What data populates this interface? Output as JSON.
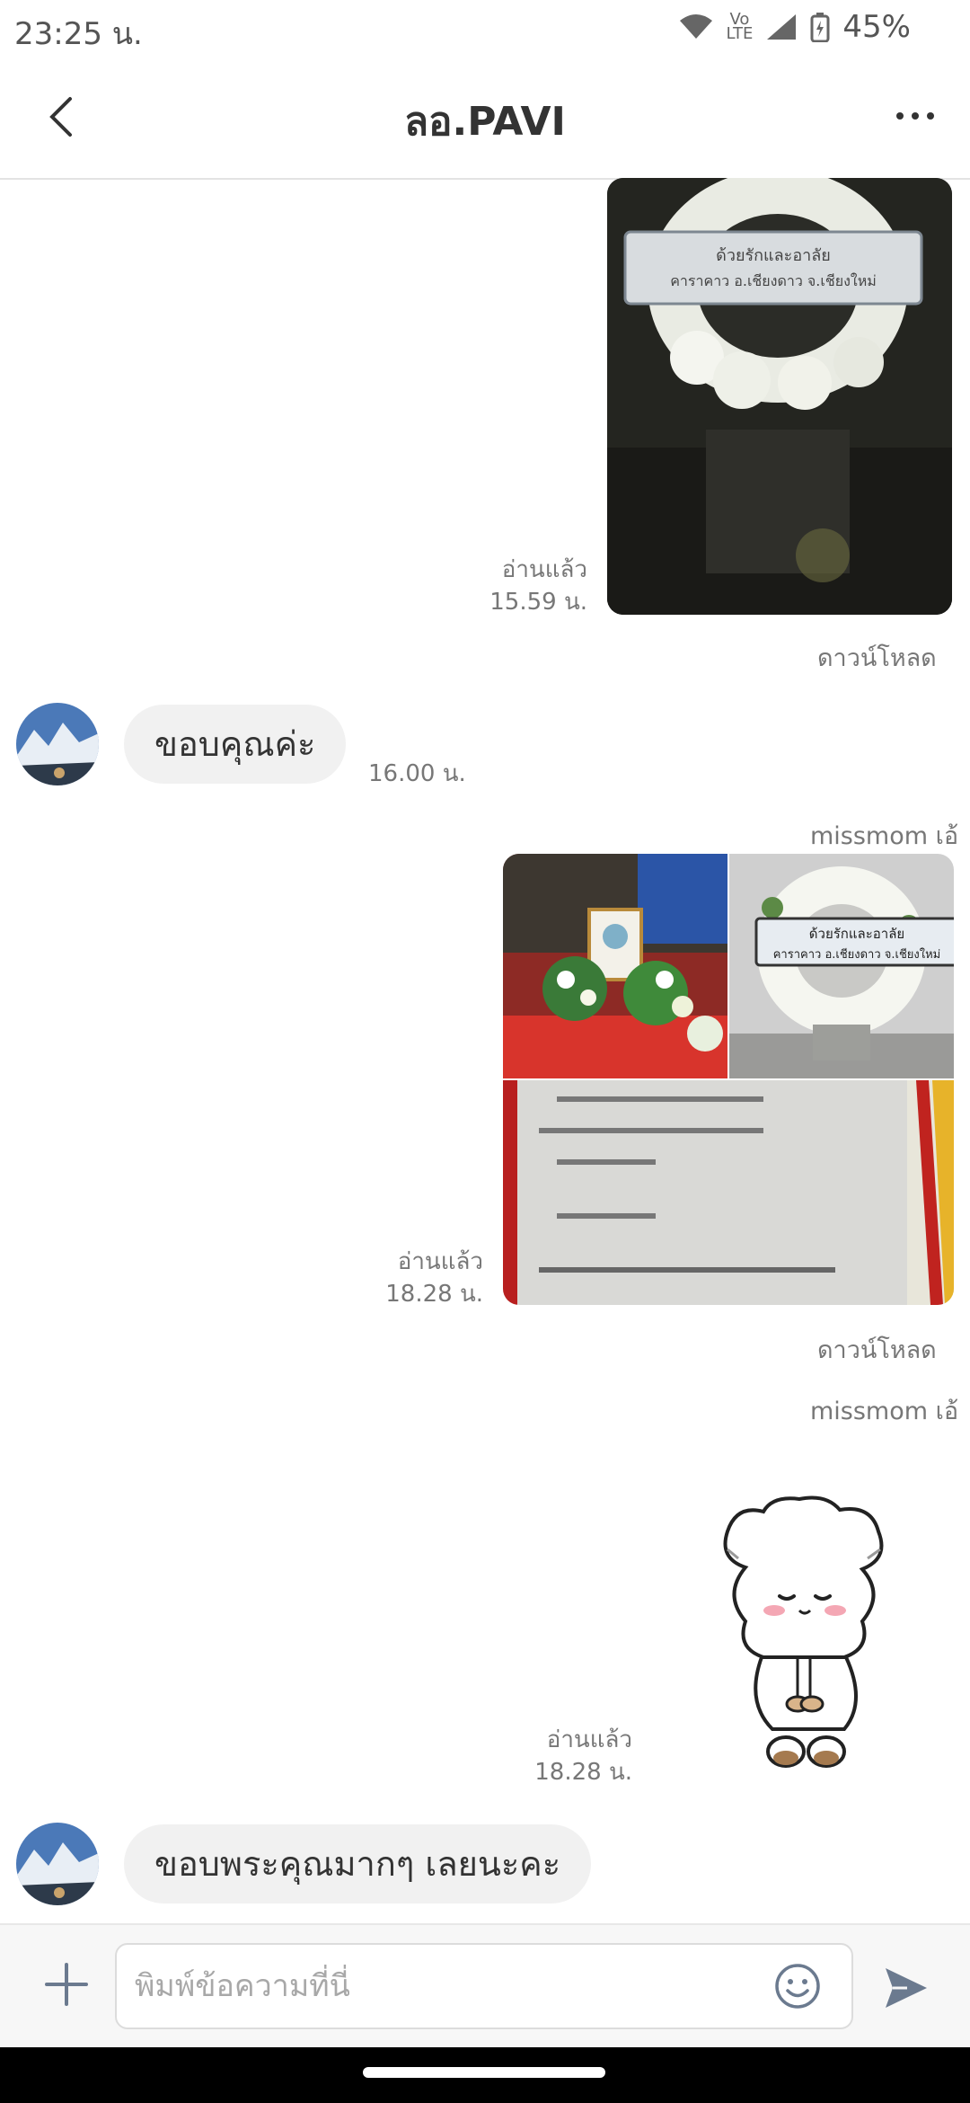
{
  "status_bar": {
    "time": "23:25 น.",
    "battery": "45%",
    "network": "LTE"
  },
  "header": {
    "title": "ลอ.PAVI"
  },
  "messages": {
    "m1": {
      "read_label": "อ่านแล้ว",
      "time": "15.59 น.",
      "download": "ดาวน์โหลด",
      "wreath_text": "ด้วยรักและอาลัย คาราคาว อ.เชียงดาว จ.เชียงใหม่"
    },
    "m2": {
      "text": "ขอบคุณค่ะ",
      "time": "16.00 น."
    },
    "m3": {
      "sender": "missmom เอ้",
      "read_label": "อ่านแล้ว",
      "time": "18.28 น.",
      "download": "ดาวน์โหลด",
      "wreath_line1": "ด้วยรักและอาลัย",
      "wreath_line2": "คาราคาว อ.เชียงดาว จ.เชียงใหม่"
    },
    "m4": {
      "sender": "missmom เอ้",
      "read_label": "อ่านแล้ว",
      "time": "18.28 น."
    },
    "m5": {
      "text": "ขอบพระคุณมากๆ เลยนะคะ"
    }
  },
  "input": {
    "placeholder": "พิมพ์ข้อความที่นี่"
  },
  "colors": {
    "accent_icon": "#6b7a8f",
    "bubble": "#f1f1f1"
  }
}
